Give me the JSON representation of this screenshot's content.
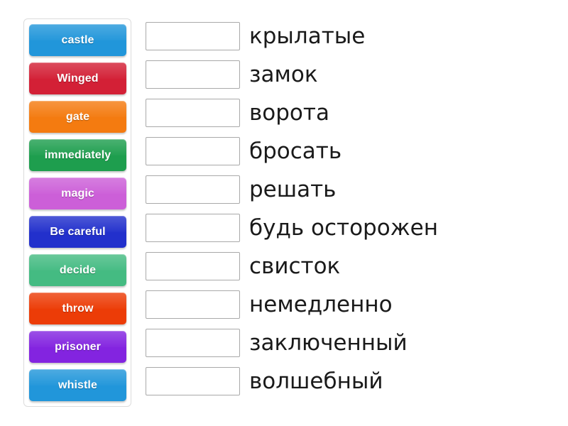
{
  "exercise": {
    "type": "match-words-drag-and-drop",
    "tiles": [
      {
        "label": "castle",
        "color": "#2196da"
      },
      {
        "label": "Winged",
        "color": "#d32036"
      },
      {
        "label": "gate",
        "color": "#f47b10"
      },
      {
        "label": "immediately",
        "color": "#1e9e4e"
      },
      {
        "label": "magic",
        "color": "#cc5fd8"
      },
      {
        "label": "Be careful",
        "color": "#2230cc"
      },
      {
        "label": "decide",
        "color": "#44bb82"
      },
      {
        "label": "throw",
        "color": "#ec3c07"
      },
      {
        "label": "prisoner",
        "color": "#8324e0"
      },
      {
        "label": "whistle",
        "color": "#2196da"
      }
    ],
    "answers": [
      {
        "value": "",
        "placeholder": "",
        "translation": "крылатые"
      },
      {
        "value": "",
        "placeholder": "",
        "translation": "замок"
      },
      {
        "value": "",
        "placeholder": "",
        "translation": "ворота"
      },
      {
        "value": "",
        "placeholder": "",
        "translation": "бросать"
      },
      {
        "value": "",
        "placeholder": "",
        "translation": "решать"
      },
      {
        "value": "",
        "placeholder": "",
        "translation": "будь осторожен"
      },
      {
        "value": "",
        "placeholder": "",
        "translation": "свисток"
      },
      {
        "value": "",
        "placeholder": "",
        "translation": "немедленно"
      },
      {
        "value": "",
        "placeholder": "",
        "translation": "заключенный"
      },
      {
        "value": "",
        "placeholder": "",
        "translation": "волшебный"
      }
    ]
  }
}
